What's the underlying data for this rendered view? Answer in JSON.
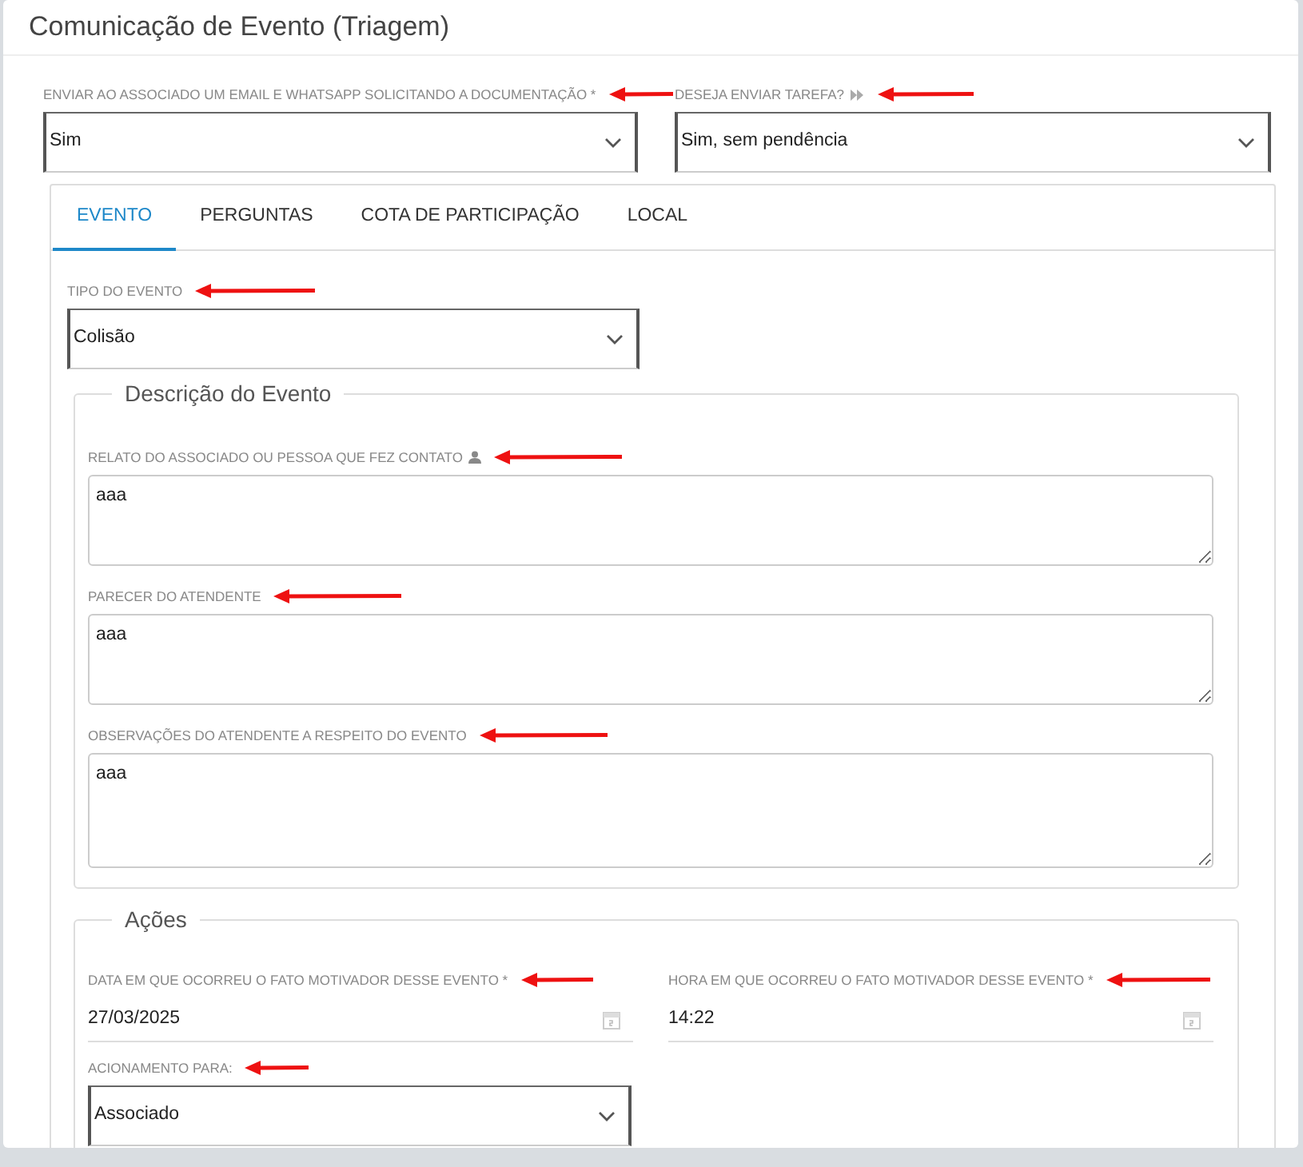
{
  "window": {
    "title": "Comunicação de Evento (Triagem)"
  },
  "top_fields": [
    {
      "label": "ENVIAR AO ASSOCIADO UM EMAIL E WHATSAPP SOLICITANDO A DOCUMENTAÇÃO *",
      "icon": false,
      "value": "Sim",
      "marked": true
    },
    {
      "label": "DESEJA ENVIAR TAREFA?",
      "icon": true,
      "value": "Sim, sem pendência",
      "marked": true
    }
  ],
  "tabs": [
    {
      "label": "EVENTO",
      "selected": true
    },
    {
      "label": "PERGUNTAS",
      "selected": false
    },
    {
      "label": "COTA DE PARTICIPAÇÃO",
      "selected": false
    },
    {
      "label": "LOCAL",
      "selected": false
    }
  ],
  "event_type": {
    "label": "TIPO DO EVENTO",
    "value": "Colisão",
    "marked": true
  },
  "description": {
    "legend": "Descrição do Evento",
    "fields": [
      {
        "label": "RELATO DO ASSOCIADO OU PESSOA QUE FEZ CONTATO",
        "icon": true,
        "value": "aaa",
        "marked": true
      },
      {
        "label": "PARECER DO ATENDENTE",
        "icon": false,
        "value": "aaa",
        "marked": true
      },
      {
        "label": "OBSERVAÇÕES DO ATENDENTE A RESPEITO DO EVENTO",
        "icon": false,
        "value": "aaa",
        "marked": true
      }
    ]
  },
  "actions": {
    "legend": "Ações",
    "date_fields": [
      {
        "label": "DATA EM QUE OCORREU O FATO MOTIVADOR DESSE EVENTO *",
        "value": "27/03/2025",
        "marked": true
      },
      {
        "label": "HORA EM QUE OCORREU O FATO MOTIVADOR DESSE EVENTO *",
        "value": "14:22",
        "marked": true
      }
    ],
    "trigger": {
      "label": "ACIONAMENTO PARA:",
      "value": "Associado",
      "marked": true
    }
  }
}
